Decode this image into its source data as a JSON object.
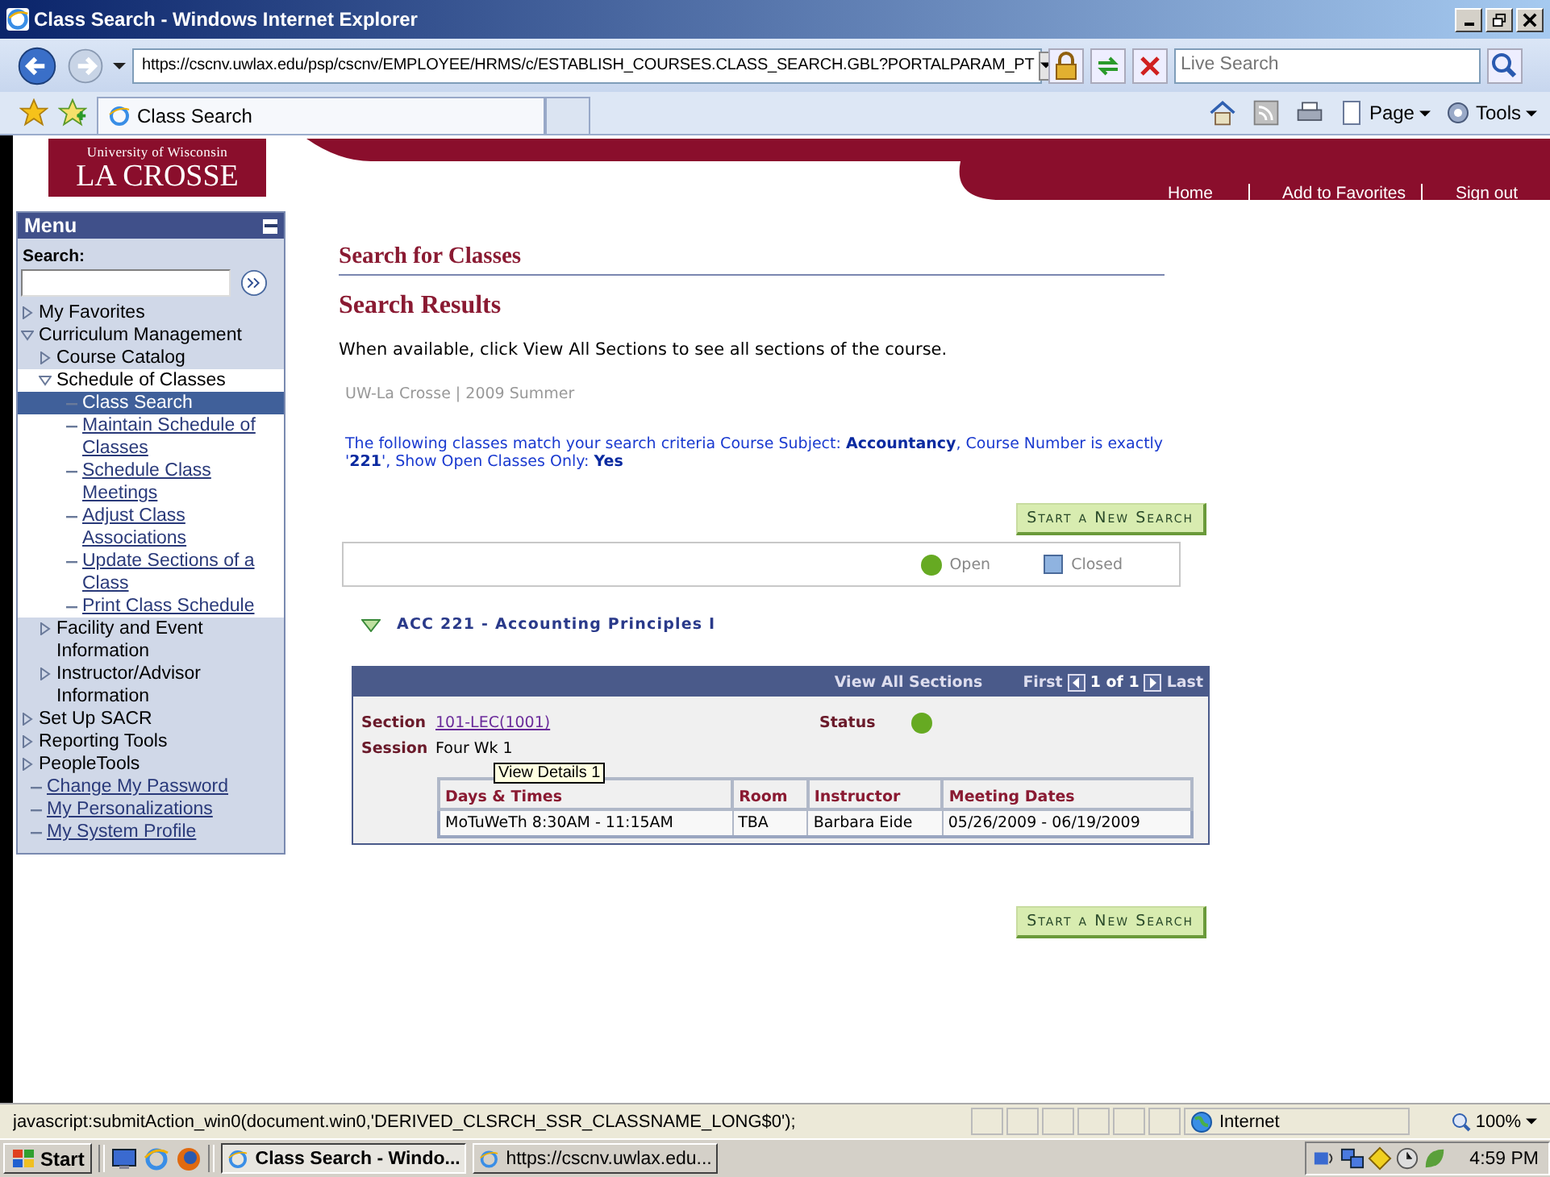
{
  "window": {
    "title": "Class Search - Windows Internet Explorer"
  },
  "address_bar": {
    "url": "https://cscnv.uwlax.edu/psp/cscnv/EMPLOYEE/HRMS/c/ESTABLISH_COURSES.CLASS_SEARCH.GBL?PORTALPARAM_PT"
  },
  "search_box": {
    "placeholder": "Live Search"
  },
  "tabs": [
    {
      "label": "Class Search",
      "selected": true
    }
  ],
  "command_bar": [
    "Page",
    "Tools"
  ],
  "header": {
    "logo_top": "University of Wisconsin",
    "logo_bottom": "LA CROSSE",
    "links": [
      "Home",
      "Add to Favorites",
      "Sign out"
    ]
  },
  "menu": {
    "title": "Menu",
    "search_label": "Search:",
    "items": [
      {
        "label": "My Favorites",
        "kind": "folder",
        "expanded": false,
        "selected": false
      },
      {
        "label": "Curriculum Management",
        "kind": "folder",
        "expanded": true,
        "selected": false,
        "children": [
          {
            "label": "Course Catalog",
            "kind": "folder",
            "expanded": false,
            "selected": false
          },
          {
            "label": "Schedule of Classes",
            "kind": "folder",
            "expanded": true,
            "selected": false,
            "children": [
              {
                "label": "Class Search",
                "kind": "link",
                "selected": true
              },
              {
                "label": "Maintain Schedule of Classes",
                "kind": "link",
                "selected": false
              },
              {
                "label": "Schedule Class Meetings",
                "kind": "link",
                "selected": false
              },
              {
                "label": "Adjust Class Associations",
                "kind": "link",
                "selected": false
              },
              {
                "label": "Update Sections of a Class",
                "kind": "link",
                "selected": false
              },
              {
                "label": "Print Class Schedule",
                "kind": "link",
                "selected": false
              }
            ]
          },
          {
            "label": "Facility and Event Information",
            "kind": "folder",
            "expanded": false,
            "selected": false
          },
          {
            "label": "Instructor/Advisor Information",
            "kind": "folder",
            "expanded": false,
            "selected": false
          }
        ]
      },
      {
        "label": "Set Up SACR",
        "kind": "folder",
        "expanded": false,
        "selected": false
      },
      {
        "label": "Reporting Tools",
        "kind": "folder",
        "expanded": false,
        "selected": false
      },
      {
        "label": "PeopleTools",
        "kind": "folder",
        "expanded": false,
        "selected": false
      },
      {
        "label": "Change My Password",
        "kind": "link",
        "selected": false
      },
      {
        "label": "My Personalizations",
        "kind": "link",
        "selected": false
      },
      {
        "label": "My System Profile",
        "kind": "link",
        "selected": false
      }
    ]
  },
  "main": {
    "title": "Search for Classes",
    "subtitle": "Search Results",
    "instruction": "When available, click View All Sections to see all sections of the course.",
    "term": "UW-La Crosse | 2009 Summer",
    "criteria": "The following classes match your search criteria Course Subject: **Accountancy**,  Course Number is exactly '**221**',  Show Open Classes Only: **Yes**",
    "new_search_button": "Start a New Search",
    "legend": [
      {
        "label": "Open",
        "kind": "circle",
        "color": "#66aa22"
      },
      {
        "label": "Closed",
        "kind": "square",
        "color": "#8fb3e0"
      }
    ],
    "course": {
      "title": "ACC  221 - Accounting Principles I",
      "expanded": true
    },
    "section_bar": {
      "view_all": "View All Sections",
      "first": "First",
      "count": "1 of 1",
      "last": "Last"
    },
    "section": {
      "section_label": "Section",
      "section_value": "101-LEC(1001)",
      "status_label": "Status",
      "status_open": true,
      "session_label": "Session",
      "session_value": "Four Wk 1"
    },
    "table": {
      "columns": [
        "Days & Times",
        "Room",
        "Instructor",
        "Meeting Dates"
      ],
      "rows": [
        [
          "MoTuWeTh 8:30AM - 11:15AM",
          "TBA",
          "Barbara Eide",
          "05/26/2009 - 06/19/2009"
        ]
      ]
    },
    "tooltip": "View Details 1",
    "new_search_button_bottom": "Start a New Search"
  },
  "status_bar": {
    "text": "javascript:submitAction_win0(document.win0,'DERIVED_CLSRCH_SSR_CLASSNAME_LONG$0');",
    "zone": "Internet",
    "zoom": "100%"
  },
  "taskbar": {
    "start": "Start",
    "tasks": [
      {
        "label": "Class Search - Windo...",
        "selected": true
      },
      {
        "label": "https://cscnv.uwlax.edu...",
        "selected": false
      }
    ],
    "clock": "4:59 PM"
  }
}
